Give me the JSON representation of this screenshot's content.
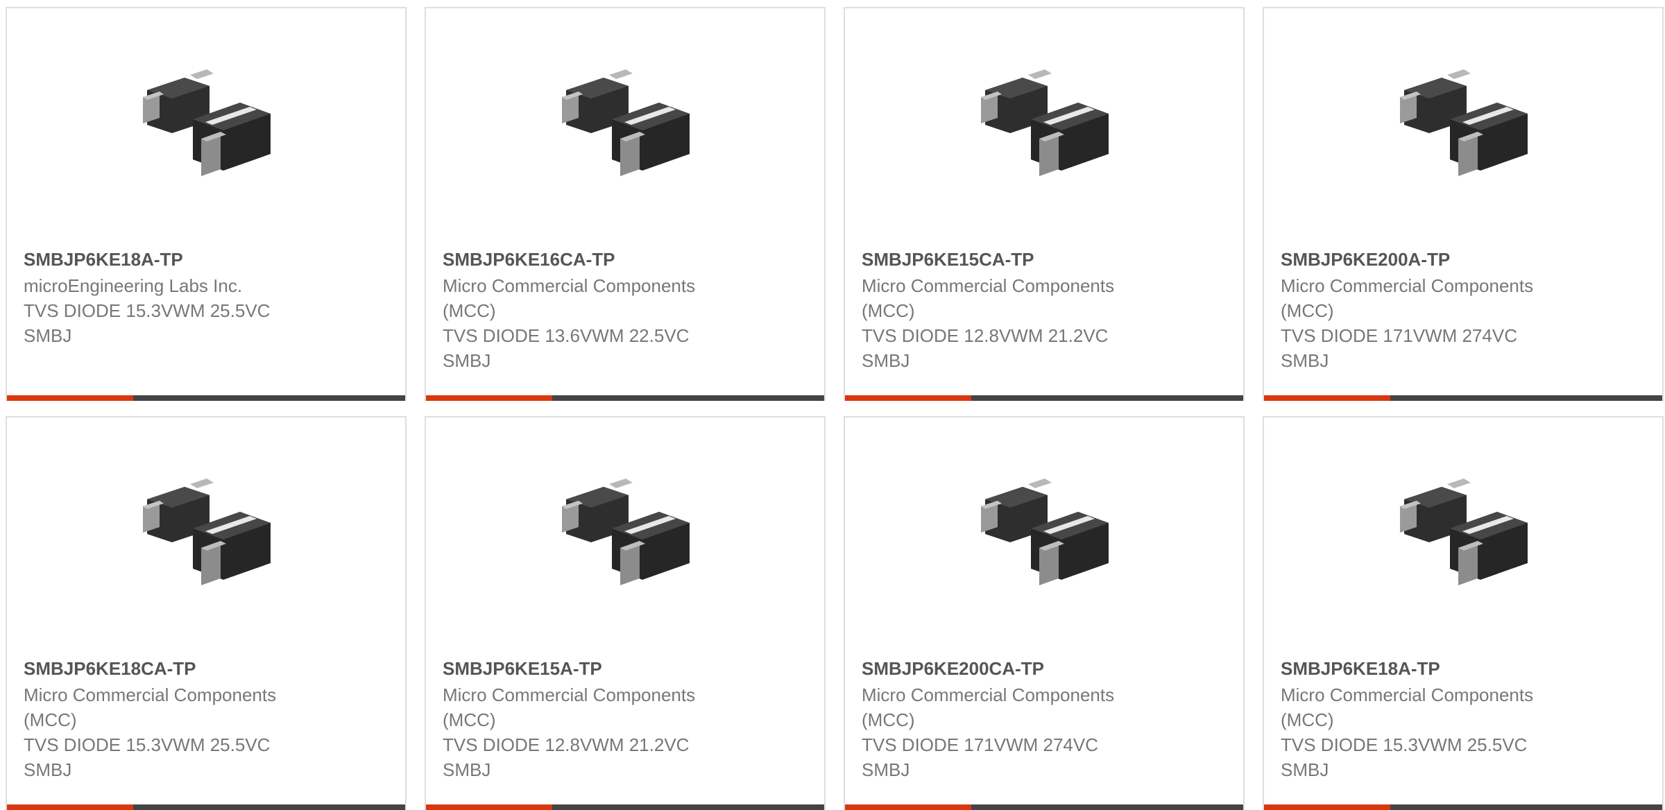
{
  "products": [
    {
      "part_number": "SMBJP6KE18A-TP",
      "manufacturer_line1": "microEngineering Labs Inc.",
      "manufacturer_line2": "",
      "description_line1": "TVS DIODE 15.3VWM 25.5VC",
      "description_line2": "SMBJ",
      "image_icon": "smbj-diode-package-image"
    },
    {
      "part_number": "SMBJP6KE16CA-TP",
      "manufacturer_line1": "Micro Commercial Components",
      "manufacturer_line2": "(MCC)",
      "description_line1": "TVS DIODE 13.6VWM 22.5VC",
      "description_line2": "SMBJ",
      "image_icon": "smbj-diode-package-image"
    },
    {
      "part_number": "SMBJP6KE15CA-TP",
      "manufacturer_line1": "Micro Commercial Components",
      "manufacturer_line2": "(MCC)",
      "description_line1": "TVS DIODE 12.8VWM 21.2VC",
      "description_line2": "SMBJ",
      "image_icon": "smbj-diode-package-image"
    },
    {
      "part_number": "SMBJP6KE200A-TP",
      "manufacturer_line1": "Micro Commercial Components",
      "manufacturer_line2": "(MCC)",
      "description_line1": "TVS DIODE 171VWM 274VC",
      "description_line2": "SMBJ",
      "image_icon": "smbj-diode-package-image"
    },
    {
      "part_number": "SMBJP6KE18CA-TP",
      "manufacturer_line1": "Micro Commercial Components",
      "manufacturer_line2": "(MCC)",
      "description_line1": "TVS DIODE 15.3VWM 25.5VC",
      "description_line2": "SMBJ",
      "image_icon": "smbj-diode-package-image"
    },
    {
      "part_number": "SMBJP6KE15A-TP",
      "manufacturer_line1": "Micro Commercial Components",
      "manufacturer_line2": "(MCC)",
      "description_line1": "TVS DIODE 12.8VWM 21.2VC",
      "description_line2": "SMBJ",
      "image_icon": "smbj-diode-package-image"
    },
    {
      "part_number": "SMBJP6KE200CA-TP",
      "manufacturer_line1": "Micro Commercial Components",
      "manufacturer_line2": "(MCC)",
      "description_line1": "TVS DIODE 171VWM 274VC",
      "description_line2": "SMBJ",
      "image_icon": "smbj-diode-package-image"
    },
    {
      "part_number": "SMBJP6KE18A-TP",
      "manufacturer_line1": "Micro Commercial Components",
      "manufacturer_line2": "(MCC)",
      "description_line1": "TVS DIODE 15.3VWM 25.5VC",
      "description_line2": "SMBJ",
      "image_icon": "smbj-diode-package-image"
    }
  ],
  "colors": {
    "accent": "#d9380f",
    "bar": "#444444",
    "border": "#dedede",
    "part_number_text": "#555555",
    "body_text": "#777777"
  }
}
